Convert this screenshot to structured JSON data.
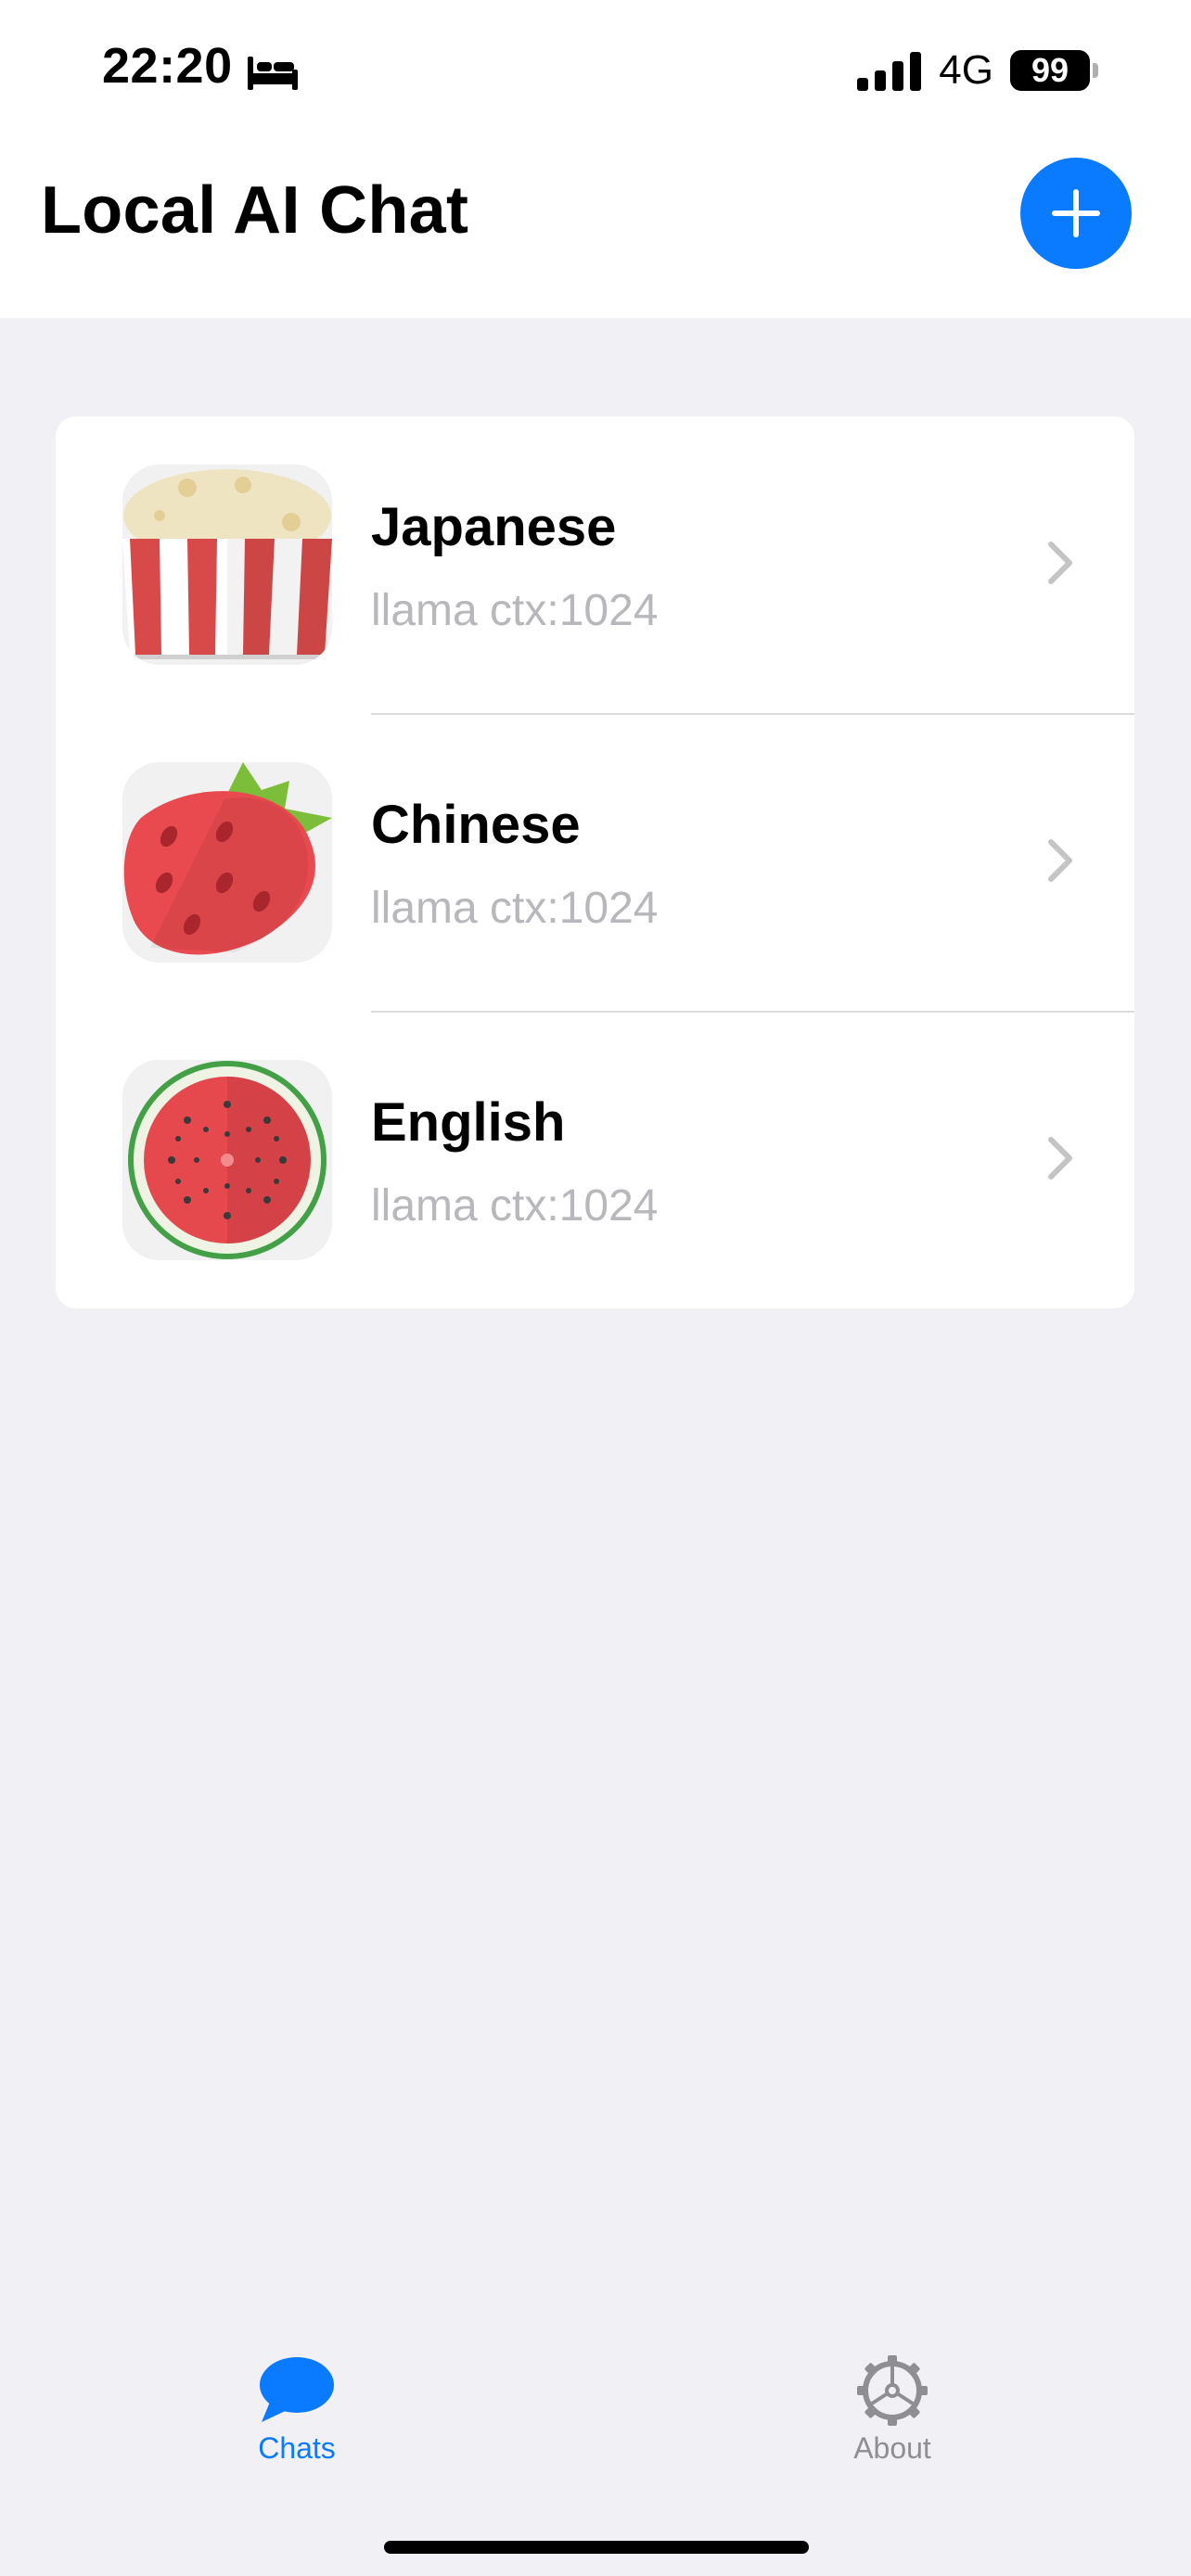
{
  "status_bar": {
    "time": "22:20",
    "network": "4G",
    "battery": "99",
    "icons": [
      "bed-icon",
      "signal-icon",
      "battery-icon"
    ]
  },
  "header": {
    "title": "Local AI Chat",
    "add_icon": "plus-icon"
  },
  "chats": [
    {
      "name": "Japanese",
      "subtitle": "llama ctx:1024",
      "icon": "popcorn-icon"
    },
    {
      "name": "Chinese",
      "subtitle": "llama ctx:1024",
      "icon": "strawberry-icon"
    },
    {
      "name": "English",
      "subtitle": "llama ctx:1024",
      "icon": "watermelon-icon"
    }
  ],
  "tab_bar": {
    "tabs": [
      {
        "label": "Chats",
        "icon": "chat-bubble-icon",
        "selected": true
      },
      {
        "label": "About",
        "icon": "gear-icon",
        "selected": false
      }
    ]
  },
  "colors": {
    "accent": "#0a7aff",
    "background": "#f0f0f5",
    "secondary_text": "#b8b8bc",
    "inactive_tab": "#8e8e93"
  }
}
